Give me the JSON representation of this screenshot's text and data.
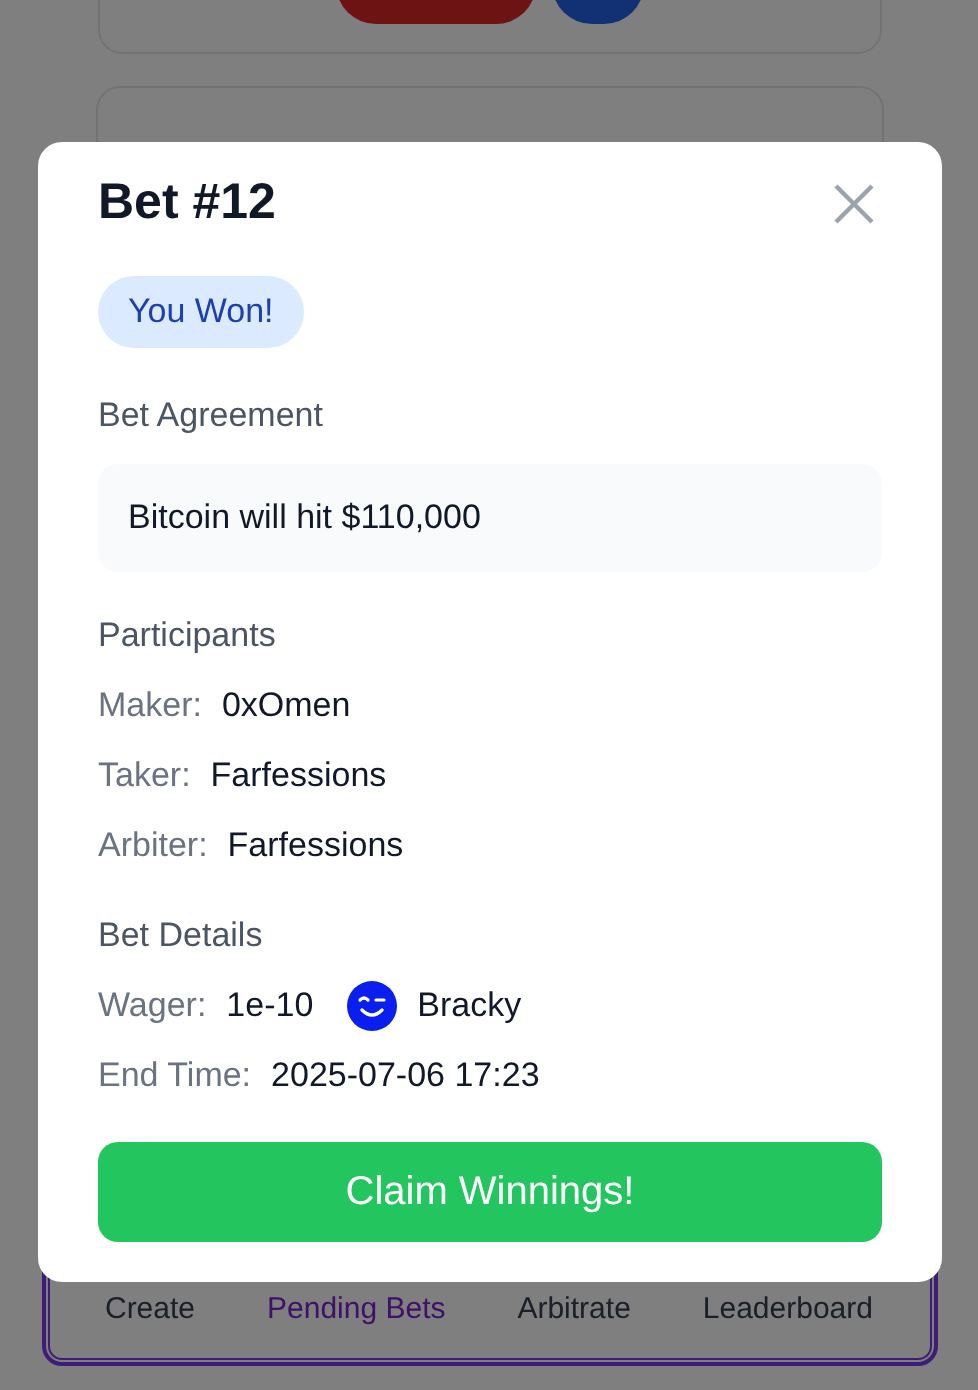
{
  "background": {
    "nav": [
      {
        "label": "Create",
        "selected": false
      },
      {
        "label": "Pending Bets",
        "selected": true
      },
      {
        "label": "Arbitrate",
        "selected": false
      },
      {
        "label": "Leaderboard",
        "selected": false
      }
    ]
  },
  "modal": {
    "title": "Bet #12",
    "status": "You Won!",
    "agreement": {
      "heading": "Bet Agreement",
      "text": "Bitcoin will hit $110,000"
    },
    "participants": {
      "heading": "Participants",
      "rows": [
        {
          "label": "Maker:",
          "value": "0xOmen"
        },
        {
          "label": "Taker:",
          "value": "Farfessions"
        },
        {
          "label": "Arbiter:",
          "value": "Farfessions"
        }
      ]
    },
    "details": {
      "heading": "Bet Details",
      "rows": [
        {
          "label": "Wager:",
          "value": "1e-10",
          "token": "Bracky"
        },
        {
          "label": "End Time:",
          "value": "2025-07-06 17:23"
        }
      ]
    },
    "action": "Claim Winnings!"
  }
}
